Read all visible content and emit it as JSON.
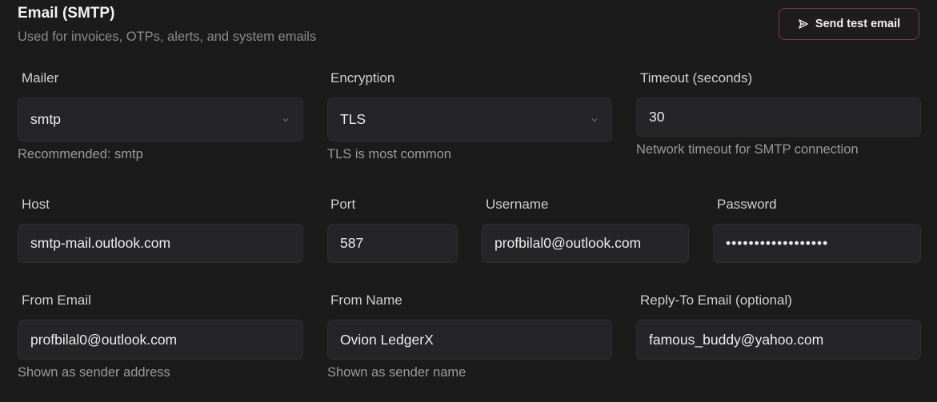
{
  "header": {
    "title": "Email (SMTP)",
    "subtitle": "Used for invoices, OTPs, alerts, and system emails",
    "test_button_label": "Send test email"
  },
  "fields": {
    "mailer": {
      "label": "Mailer",
      "value": "smtp",
      "hint": "Recommended: smtp"
    },
    "encryption": {
      "label": "Encryption",
      "value": "TLS",
      "hint": "TLS is most common"
    },
    "timeout": {
      "label": "Timeout (seconds)",
      "value": "30",
      "hint": "Network timeout for SMTP connection"
    },
    "host": {
      "label": "Host",
      "value": "smtp-mail.outlook.com"
    },
    "port": {
      "label": "Port",
      "value": "587"
    },
    "username": {
      "label": "Username",
      "value": "profbilal0@outlook.com"
    },
    "password": {
      "label": "Password",
      "value": "••••••••••••••••••"
    },
    "from_email": {
      "label": "From Email",
      "value": "profbilal0@outlook.com",
      "hint": "Shown as sender address"
    },
    "from_name": {
      "label": "From Name",
      "value": "Ovion LedgerX",
      "hint": "Shown as sender name"
    },
    "reply_to": {
      "label": "Reply-To Email (optional)",
      "value": "famous_buddy@yahoo.com"
    }
  },
  "icons": {
    "send": "send-icon",
    "chevron": "chevron-down-icon"
  },
  "colors": {
    "background": "#1b1b1c",
    "field": "#252527",
    "accent_border": "#7b3846"
  }
}
